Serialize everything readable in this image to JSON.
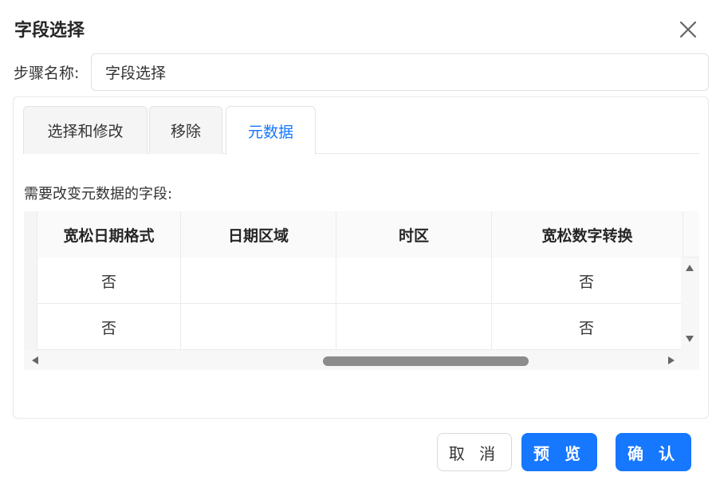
{
  "dialog": {
    "title": "字段选择",
    "step_label": "步骤名称:",
    "step_value": "字段选择"
  },
  "tabs": [
    {
      "label": "选择和修改",
      "active": false
    },
    {
      "label": "移除",
      "active": false
    },
    {
      "label": "元数据",
      "active": true
    }
  ],
  "section_label": "需要改变元数据的字段:",
  "table": {
    "columns": [
      "宽松日期格式",
      "日期区域",
      "时区",
      "宽松数字转换"
    ],
    "rows": [
      [
        "否",
        "",
        "",
        "否"
      ],
      [
        "否",
        "",
        "",
        "否"
      ]
    ]
  },
  "buttons": {
    "cancel": "取 消",
    "preview": "预 览",
    "confirm": "确 认"
  },
  "colors": {
    "primary": "#1677ff",
    "border": "#dcdfe6"
  },
  "icons": {
    "close": "close-icon",
    "scroll_up": "arrow-up-icon",
    "scroll_down": "arrow-down-icon",
    "scroll_left": "arrow-left-icon",
    "scroll_right": "arrow-right-icon"
  }
}
